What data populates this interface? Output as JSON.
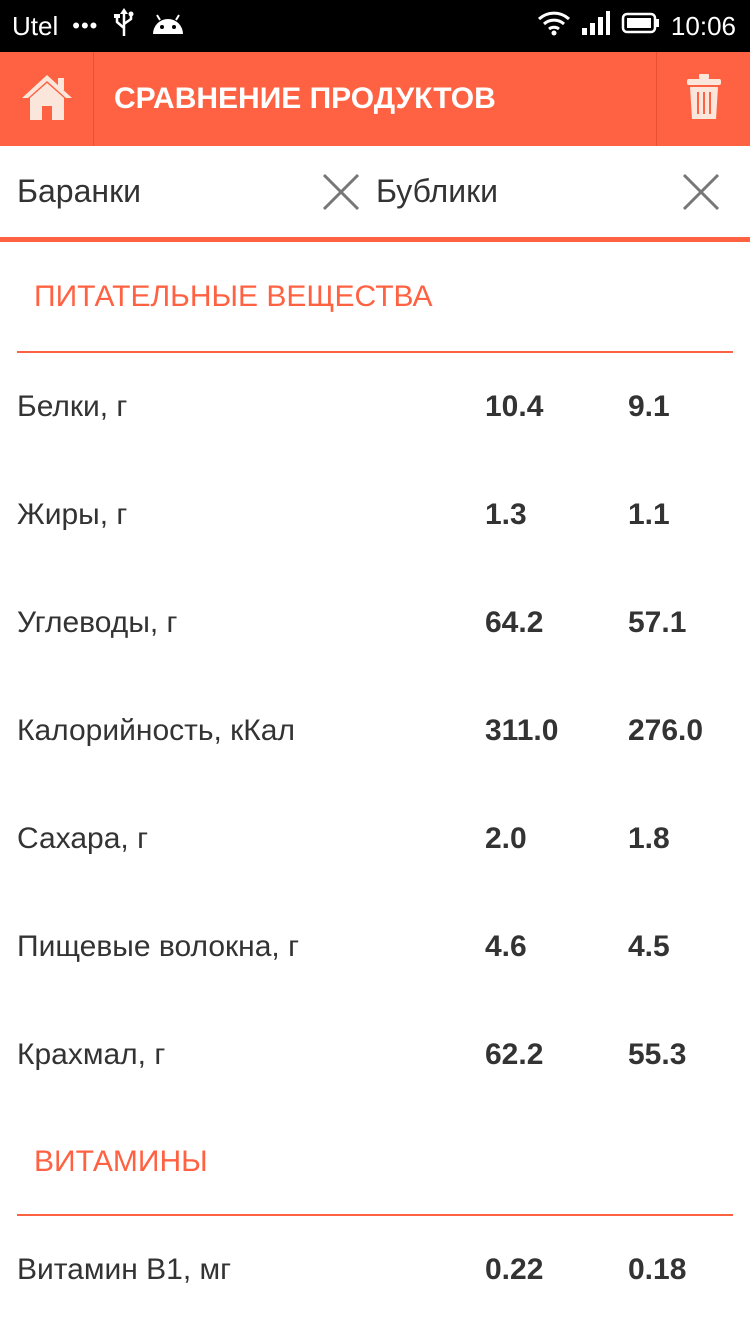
{
  "status_bar": {
    "carrier": "Utel",
    "dots": "•••",
    "time": "10:06"
  },
  "app_bar": {
    "title": "СРАВНЕНИЕ ПРОДУКТОВ",
    "home_icon": "home-icon",
    "trash_icon": "trash-icon"
  },
  "products": [
    {
      "name": "Баранки"
    },
    {
      "name": "Бублики"
    }
  ],
  "sections": {
    "nutrients": {
      "title": "ПИТАТЕЛЬНЫЕ ВЕЩЕСТВА",
      "rows": [
        {
          "label": "Белки, г",
          "v1": "10.4",
          "v2": "9.1"
        },
        {
          "label": "Жиры, г",
          "v1": "1.3",
          "v2": "1.1"
        },
        {
          "label": "Углеводы, г",
          "v1": "64.2",
          "v2": "57.1"
        },
        {
          "label": "Калорийность, кКал",
          "v1": "311.0",
          "v2": "276.0"
        },
        {
          "label": "Сахара, г",
          "v1": "2.0",
          "v2": "1.8"
        },
        {
          "label": "Пищевые волокна, г",
          "v1": "4.6",
          "v2": "4.5"
        },
        {
          "label": "Крахмал, г",
          "v1": "62.2",
          "v2": "55.3"
        }
      ]
    },
    "vitamins": {
      "title": "ВИТАМИНЫ",
      "rows": [
        {
          "label": "Витамин B1, мг",
          "v1": "0.22",
          "v2": "0.18"
        }
      ]
    }
  },
  "colors": {
    "accent": "#ff6242",
    "text": "#333333",
    "status_bar_bg": "#000000"
  }
}
